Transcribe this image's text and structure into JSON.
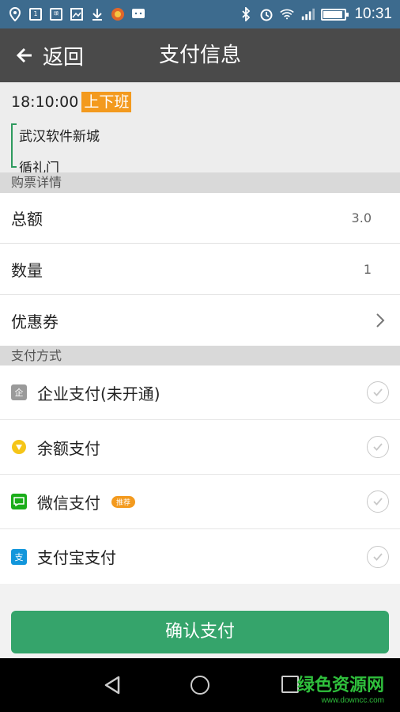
{
  "statusbar": {
    "left_icons": [
      "location-icon",
      "sim-icon",
      "news-icon",
      "image-icon",
      "download-icon",
      "app-icon",
      "message-icon"
    ],
    "right_icons": [
      "bluetooth-icon",
      "alarm-icon",
      "wifi-icon",
      "signal-icon",
      "battery-icon"
    ],
    "time": "10:31",
    "battery_level": 0.9
  },
  "titlebar": {
    "back_label": "返回",
    "title": "支付信息"
  },
  "trip": {
    "time": "18:10:00",
    "tag": "上下班",
    "from": "武汉软件新城",
    "to": "循礼门"
  },
  "ticket_section": {
    "title": "购票详情",
    "rows": [
      {
        "label": "总额",
        "value": "3.0"
      },
      {
        "label": "数量",
        "value": "1"
      },
      {
        "label": "优惠券",
        "value": ""
      }
    ]
  },
  "payment_section": {
    "title": "支付方式",
    "methods": [
      {
        "label": "企业支付(未开通)",
        "icon": "enterprise-icon",
        "badge": ""
      },
      {
        "label": "余额支付",
        "icon": "balance-icon",
        "badge": ""
      },
      {
        "label": "微信支付",
        "icon": "wechat-icon",
        "badge": "推荐"
      },
      {
        "label": "支付宝支付",
        "icon": "alipay-icon",
        "badge": ""
      }
    ]
  },
  "confirm_label": "确认支付",
  "watermark": {
    "title": "绿色资源网",
    "url": "www.downcc.com"
  },
  "colors": {
    "statusbar": "#3d6b8e",
    "titlebar": "#4a4a4a",
    "accent_green": "#35a46b",
    "tag_orange": "#f39a1e"
  }
}
